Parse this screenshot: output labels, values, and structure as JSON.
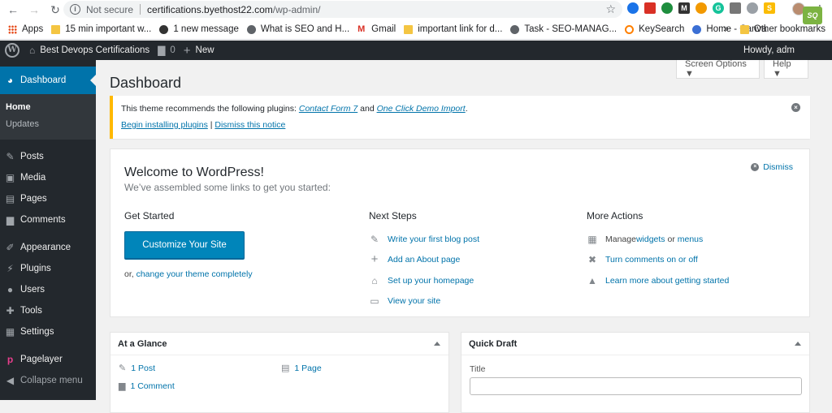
{
  "browser": {
    "url_security": "Not secure",
    "url_host": "certifications.byethost22.com",
    "url_path": "/wp-admin/",
    "bookmarks": [
      {
        "label": "Apps",
        "icon": "apps-grid-icon"
      },
      {
        "label": "15 min important w...",
        "icon": "folder-icon"
      },
      {
        "label": "1 new message",
        "icon": "message-icon"
      },
      {
        "label": "What is SEO and H...",
        "icon": "globe-icon"
      },
      {
        "label": "Gmail",
        "icon": "gmail-icon"
      },
      {
        "label": "important link for d...",
        "icon": "folder-icon"
      },
      {
        "label": "Task - SEO-MANAG...",
        "icon": "globe-icon"
      },
      {
        "label": "KeySearch",
        "icon": "keysearch-icon"
      },
      {
        "label": "Home - Canva",
        "icon": "canva-icon"
      }
    ],
    "bookmarks_overflow": "»",
    "other_bookmarks": "Other bookmarks"
  },
  "adminbar": {
    "site_name": "Best Devops Certifications",
    "comments_count": "0",
    "new_label": "New",
    "howdy": "Howdy, adm"
  },
  "sidebar": {
    "dashboard": "Dashboard",
    "sub": [
      "Home",
      "Updates"
    ],
    "items": [
      "Posts",
      "Media",
      "Pages",
      "Comments",
      "Appearance",
      "Plugins",
      "Users",
      "Tools",
      "Settings",
      "Pagelayer",
      "Collapse menu"
    ]
  },
  "screen_options": "Screen Options ▼",
  "help": "Help ▼",
  "page_title": "Dashboard",
  "notice": {
    "text_prefix": "This theme recommends the following plugins: ",
    "plugin1": "Contact Form 7",
    "and": " and ",
    "plugin2": "One Click Demo Import",
    "suffix": ".",
    "begin": "Begin installing plugins",
    "pipe": " | ",
    "dismiss": "Dismiss this notice"
  },
  "welcome": {
    "title": "Welcome to WordPress!",
    "about": "We’ve assembled some links to get you started:",
    "dismiss": "Dismiss",
    "get_started": "Get Started",
    "customize": "Customize Your Site",
    "or": "or, ",
    "change_theme": "change your theme completely",
    "next_steps": "Next Steps",
    "steps": [
      {
        "label": "Write your first blog post",
        "icon": "edit-page-icon"
      },
      {
        "label": "Add an About page",
        "icon": "plus-icon"
      },
      {
        "label": "Set up your homepage",
        "icon": "home-icon"
      },
      {
        "label": "View your site",
        "icon": "view-site-icon"
      }
    ],
    "more_actions": "More Actions",
    "manage_prefix": "Manage ",
    "widgets": "widgets",
    "or_word": " or ",
    "menus": "menus",
    "comments_toggle": "Turn comments on or off",
    "learn_more": "Learn more about getting started"
  },
  "glance": {
    "title": "At a Glance",
    "posts": "1 Post",
    "pages": "1 Page",
    "comments": "1 Comment"
  },
  "quick_draft": {
    "title": "Quick Draft",
    "field_label": "Title"
  }
}
